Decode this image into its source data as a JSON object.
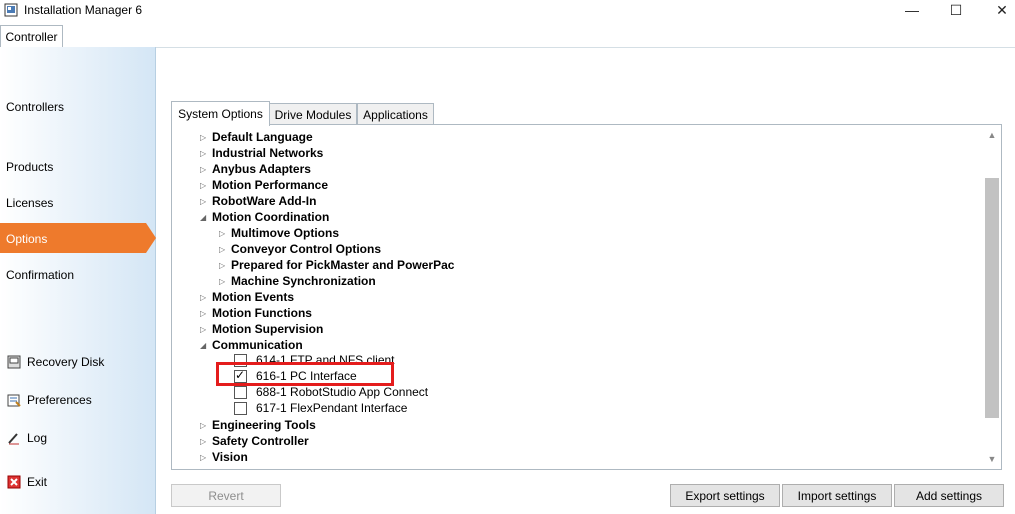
{
  "app": {
    "title": "Installation Manager 6"
  },
  "window_controls": {
    "minimize": "—",
    "maximize": "☐",
    "close": "✕"
  },
  "top_tab": {
    "label": "Controller"
  },
  "sidebar": {
    "items": [
      "Controllers",
      "Products",
      "Licenses",
      "Options",
      "Confirmation"
    ],
    "active": "Options",
    "tools": [
      {
        "label": "Recovery Disk",
        "icon": "recovery-disk-icon"
      },
      {
        "label": "Preferences",
        "icon": "preferences-icon"
      },
      {
        "label": "Log",
        "icon": "log-icon"
      },
      {
        "label": "Exit",
        "icon": "exit-icon"
      }
    ]
  },
  "tabs": [
    "System Options",
    "Drive Modules",
    "Applications"
  ],
  "tree": {
    "default_language": "Default Language",
    "industrial_networks": "Industrial Networks",
    "anybus_adapters": "Anybus Adapters",
    "motion_performance": "Motion Performance",
    "robotware_addin": "RobotWare Add-In",
    "motion_coordination": "Motion Coordination",
    "multimove": "Multimove Options",
    "conveyor": "Conveyor Control Options",
    "pickmaster": "Prepared for PickMaster and PowerPac",
    "machine_sync": "Machine Synchronization",
    "motion_events": "Motion Events",
    "motion_functions": "Motion Functions",
    "motion_supervision": "Motion Supervision",
    "communication": "Communication",
    "opt_614": "614-1 FTP and NFS client",
    "opt_616": "616-1 PC Interface",
    "opt_688": "688-1 RobotStudio App Connect",
    "opt_617": "617-1 FlexPendant Interface",
    "engineering_tools": "Engineering Tools",
    "safety_controller": "Safety Controller",
    "vision": "Vision"
  },
  "options_checked": {
    "opt_614": false,
    "opt_616": true,
    "opt_688": false,
    "opt_617": false
  },
  "buttons": {
    "revert": "Revert",
    "export": "Export settings",
    "import": "Import settings",
    "add": "Add settings"
  },
  "colors": {
    "accent": "#ee7a2c",
    "highlight_box": "#e41c1c"
  }
}
